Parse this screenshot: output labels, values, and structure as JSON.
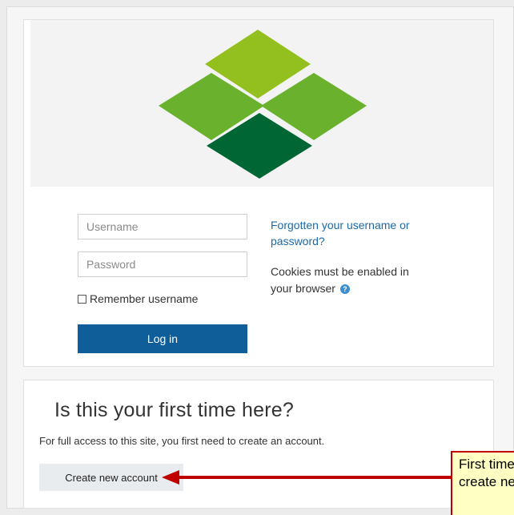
{
  "login": {
    "username_placeholder": "Username",
    "password_placeholder": "Password",
    "remember_label": "Remember username",
    "login_button": "Log in",
    "forgot_link": "Forgotten your username or password?",
    "cookies_text": "Cookies must be enabled in your browser",
    "help_icon_glyph": "?"
  },
  "signup": {
    "title": "Is this your first time here?",
    "description": "For full access to this site, you first need to create an account.",
    "create_button": "Create new account"
  },
  "callout": {
    "line1": "First time in",
    "line2": "create new"
  },
  "colors": {
    "logo_top": "#93c01f",
    "logo_left": "#6ab22e",
    "logo_right": "#6ab22e",
    "logo_bottom": "#006633",
    "login_button": "#105e99",
    "link": "#1a6aa8",
    "callout_border": "#c00000",
    "callout_fill": "#ffffc4"
  }
}
